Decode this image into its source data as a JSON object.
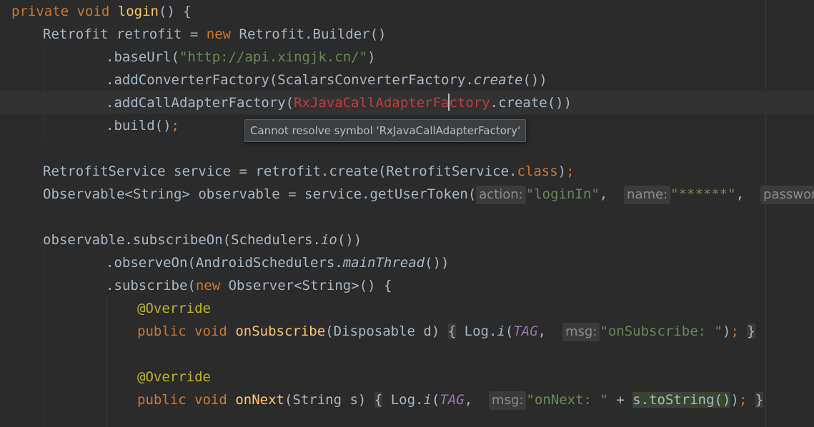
{
  "editor": {
    "line1": {
      "kw1": "private",
      "kw2": "void",
      "fn": "login",
      "rest": "() {"
    },
    "line2": {
      "a": "Retrofit retrofit = ",
      "kw": "new",
      "b": " Retrofit.Builder()"
    },
    "line3": {
      "a": ".baseUrl(",
      "str": "\"http://api.xingjk.cn/\"",
      "b": ")"
    },
    "line4": {
      "a": ".addConverterFactory(ScalarsConverterFactory.",
      "it": "create",
      "b": "())"
    },
    "line5": {
      "a": ".addCallAdapterFactory(",
      "err1": "RxJavaCallAdapterFa",
      "err2": "ctory",
      "b": ".create())"
    },
    "line6": {
      "a": ".build()",
      "semi": ";"
    },
    "line8": {
      "a": "RetrofitService service = retrofit.create(RetrofitService.",
      "kw": "class",
      "b": ")",
      "semi": ";"
    },
    "line9": {
      "a": "Observable<String> observable = service.getUserToken(",
      "hint1": "action:",
      "s1": "\"loginIn\"",
      "c1": ", ",
      "hint2": "name:",
      "s2": "\"******\"",
      "c2": ", ",
      "hint3": "password:",
      "s3": "\""
    },
    "line11": {
      "a": "observable.subscribeOn(Schedulers.",
      "it": "io",
      "b": "())"
    },
    "line12": {
      "a": ".observeOn(AndroidSchedulers.",
      "it": "mainThread",
      "b": "())"
    },
    "line13": {
      "a": ".subscribe(",
      "kw": "new",
      "b": " Observer<String>() {"
    },
    "line14": {
      "ann": "@Override"
    },
    "line15": {
      "kw1": "public",
      "kw2": "void",
      "fn": "onSubscribe",
      "a": "(Disposable d) ",
      "ob": "{",
      "b": " Log.",
      "it": "i",
      "p": "(",
      "tag": "TAG",
      "c": ", ",
      "hint": "msg:",
      "str": "\"onSubscribe: \"",
      "e": ")",
      "semi": ";",
      "cb": "}"
    },
    "line17": {
      "ann": "@Override"
    },
    "line18": {
      "kw1": "public",
      "kw2": "void",
      "fn": "onNext",
      "a": "(String s) ",
      "ob": "{",
      "b": " Log.",
      "it": "i",
      "p": "(",
      "tag": "TAG",
      "c": ", ",
      "hint": "msg:",
      "str": "\"onNext: \"",
      "plus": " + ",
      "hl": "s.toString()",
      "e": ")",
      "semi": ";",
      "cb": "}"
    }
  },
  "tooltip": {
    "text": "Cannot resolve symbol 'RxJavaCallAdapterFactory'"
  }
}
